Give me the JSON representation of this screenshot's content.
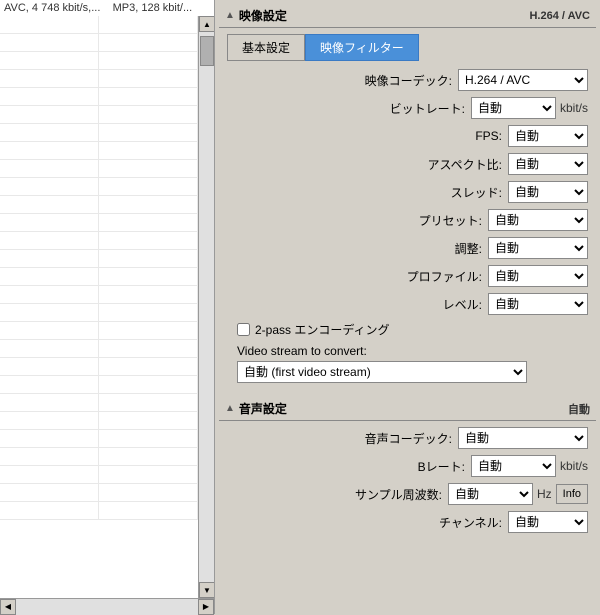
{
  "left_panel": {
    "top_text": "AVC, 4 748 kbit/s,...",
    "top_text2": "MP3, 128 kbit/...",
    "rows": [
      {
        "col1": "",
        "col2": ""
      },
      {
        "col1": "",
        "col2": ""
      },
      {
        "col1": "",
        "col2": ""
      },
      {
        "col1": "",
        "col2": ""
      },
      {
        "col1": "",
        "col2": ""
      },
      {
        "col1": "",
        "col2": ""
      },
      {
        "col1": "",
        "col2": ""
      },
      {
        "col1": "",
        "col2": ""
      },
      {
        "col1": "",
        "col2": ""
      },
      {
        "col1": "",
        "col2": ""
      },
      {
        "col1": "",
        "col2": ""
      },
      {
        "col1": "",
        "col2": ""
      },
      {
        "col1": "",
        "col2": ""
      },
      {
        "col1": "",
        "col2": ""
      },
      {
        "col1": "",
        "col2": ""
      },
      {
        "col1": "",
        "col2": ""
      },
      {
        "col1": "",
        "col2": ""
      },
      {
        "col1": "",
        "col2": ""
      },
      {
        "col1": "",
        "col2": ""
      },
      {
        "col1": "",
        "col2": ""
      },
      {
        "col1": "",
        "col2": ""
      },
      {
        "col1": "",
        "col2": ""
      },
      {
        "col1": "",
        "col2": ""
      },
      {
        "col1": "",
        "col2": ""
      },
      {
        "col1": "",
        "col2": ""
      },
      {
        "col1": "",
        "col2": ""
      },
      {
        "col1": "",
        "col2": ""
      },
      {
        "col1": "",
        "col2": ""
      }
    ]
  },
  "video_settings": {
    "section_title": "映像設定",
    "badge": "H.264 / AVC",
    "tab_basic": "基本設定",
    "tab_filter": "映像フィルター",
    "codec_label": "映像コーデック:",
    "codec_value": "H.264 / AVC",
    "bitrate_label": "ビットレート:",
    "bitrate_value": "自動",
    "bitrate_unit": "kbit/s",
    "fps_label": "FPS:",
    "fps_value": "自動",
    "aspect_label": "アスペクト比:",
    "aspect_value": "自動",
    "thread_label": "スレッド:",
    "thread_value": "自動",
    "preset_label": "プリセット:",
    "preset_value": "自動",
    "tune_label": "調整:",
    "tune_value": "自動",
    "profile_label": "プロファイル:",
    "profile_value": "自動",
    "level_label": "レベル:",
    "level_value": "自動",
    "twopass_label": "2-pass エンコーディング",
    "stream_label": "Video stream to convert:",
    "stream_value": "自動 (first video stream)"
  },
  "audio_settings": {
    "section_title": "音声設定",
    "badge": "自動",
    "codec_label": "音声コーデック:",
    "codec_value": "自動",
    "bitrate_label": "Bレート:",
    "bitrate_value": "自動",
    "bitrate_unit": "kbit/s",
    "samplerate_label": "サンプル周波数:",
    "samplerate_value": "自動",
    "samplerate_unit": "Hz",
    "info_button": "Info",
    "channel_label": "チャンネル:",
    "channel_value": "自動"
  }
}
